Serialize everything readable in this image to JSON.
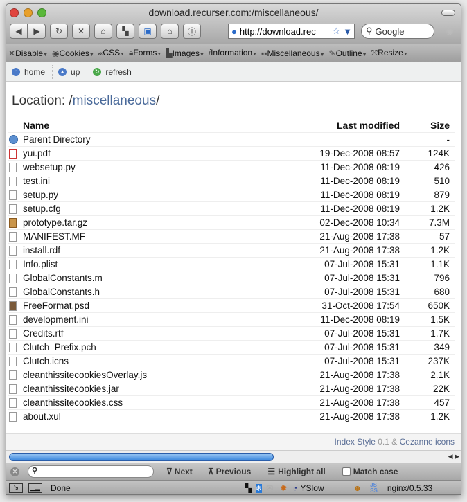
{
  "window": {
    "title": "download.recurser.com:/miscellaneous/"
  },
  "toolbar": {
    "url": "http://download.recurser.com/miscellaneous/",
    "url_visible": "http://download.rec",
    "search_placeholder": "Google"
  },
  "devbar": {
    "items": [
      {
        "icon": "x-icon",
        "label": "Disable"
      },
      {
        "icon": "cookie-icon",
        "label": "Cookies"
      },
      {
        "icon": "css-icon",
        "label": "CSS"
      },
      {
        "icon": "lock-icon",
        "label": "Forms"
      },
      {
        "icon": "image-icon",
        "label": "Images"
      },
      {
        "icon": "info-icon",
        "label": "Information"
      },
      {
        "icon": "grid-icon",
        "label": "Miscellaneous"
      },
      {
        "icon": "pencil-icon",
        "label": "Outline"
      },
      {
        "icon": "resize-icon",
        "label": "Resize"
      }
    ]
  },
  "bookmarks": [
    {
      "label": "home",
      "color": "#4a7ac8"
    },
    {
      "label": "up",
      "color": "#4a7ac8"
    },
    {
      "label": "refresh",
      "color": "#4aa84a"
    }
  ],
  "page": {
    "location_label": "Location: /",
    "location_dir": "miscellaneous",
    "location_suffix": "/",
    "columns": {
      "name": "Name",
      "modified": "Last modified",
      "size": "Size"
    },
    "files": [
      {
        "name": "Parent Directory",
        "modified": "",
        "size": "-",
        "icon": "back"
      },
      {
        "name": "yui.pdf",
        "modified": "19-Dec-2008 08:57",
        "size": "124K",
        "icon": "pdf"
      },
      {
        "name": "websetup.py",
        "modified": "11-Dec-2008 08:19",
        "size": "426",
        "icon": "file"
      },
      {
        "name": "test.ini",
        "modified": "11-Dec-2008 08:19",
        "size": "510",
        "icon": "file"
      },
      {
        "name": "setup.py",
        "modified": "11-Dec-2008 08:19",
        "size": "879",
        "icon": "file"
      },
      {
        "name": "setup.cfg",
        "modified": "11-Dec-2008 08:19",
        "size": "1.2K",
        "icon": "file"
      },
      {
        "name": "prototype.tar.gz",
        "modified": "02-Dec-2008 10:34",
        "size": "7.3M",
        "icon": "pkg"
      },
      {
        "name": "MANIFEST.MF",
        "modified": "21-Aug-2008 17:38",
        "size": "57",
        "icon": "file"
      },
      {
        "name": "install.rdf",
        "modified": "21-Aug-2008 17:38",
        "size": "1.2K",
        "icon": "file"
      },
      {
        "name": "Info.plist",
        "modified": "07-Jul-2008 15:31",
        "size": "1.1K",
        "icon": "file"
      },
      {
        "name": "GlobalConstants.m",
        "modified": "07-Jul-2008 15:31",
        "size": "796",
        "icon": "file"
      },
      {
        "name": "GlobalConstants.h",
        "modified": "07-Jul-2008 15:31",
        "size": "680",
        "icon": "file"
      },
      {
        "name": "FreeFormat.psd",
        "modified": "31-Oct-2008 17:54",
        "size": "650K",
        "icon": "psd"
      },
      {
        "name": "development.ini",
        "modified": "11-Dec-2008 08:19",
        "size": "1.5K",
        "icon": "file"
      },
      {
        "name": "Credits.rtf",
        "modified": "07-Jul-2008 15:31",
        "size": "1.7K",
        "icon": "file"
      },
      {
        "name": "Clutch_Prefix.pch",
        "modified": "07-Jul-2008 15:31",
        "size": "349",
        "icon": "file"
      },
      {
        "name": "Clutch.icns",
        "modified": "07-Jul-2008 15:31",
        "size": "237K",
        "icon": "file"
      },
      {
        "name": "cleanthissitecookiesOverlay.js",
        "modified": "21-Aug-2008 17:38",
        "size": "2.1K",
        "icon": "file"
      },
      {
        "name": "cleanthissitecookies.jar",
        "modified": "21-Aug-2008 17:38",
        "size": "22K",
        "icon": "file"
      },
      {
        "name": "cleanthissitecookies.css",
        "modified": "21-Aug-2008 17:38",
        "size": "457",
        "icon": "file"
      },
      {
        "name": "about.xul",
        "modified": "21-Aug-2008 17:38",
        "size": "1.2K",
        "icon": "file"
      }
    ],
    "footer": {
      "a": "Index Style",
      "v": " 0.1 & ",
      "b": "Cezanne icons"
    }
  },
  "scroll": {
    "horizontal_position_percent": 0
  },
  "findbar": {
    "next": "Next",
    "previous": "Previous",
    "highlight": "Highlight all",
    "match_case": "Match case"
  },
  "status": {
    "text": "Done",
    "yslow": "YSlow",
    "server": "nginx/0.5.33"
  }
}
